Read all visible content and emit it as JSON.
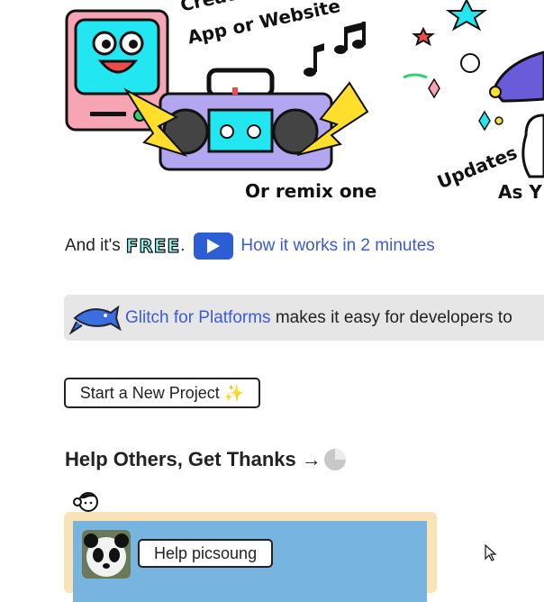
{
  "hero": {
    "create_line1": "Create an",
    "create_line2": "App or Website",
    "remix": "Or remix one",
    "updates": "Updates",
    "as_y": "As Y"
  },
  "free_line": {
    "prefix": "And it's",
    "free_badge": "FREE",
    "period": ".",
    "how_link": "How it works in 2 minutes"
  },
  "platforms": {
    "link": "Glitch for Platforms",
    "text": " makes it easy for developers to"
  },
  "start_button": "Start a New Project ✨",
  "help": {
    "heading": "Help Others, Get Thanks",
    "arrow": "→",
    "button": "Help picsoung"
  },
  "colors": {
    "accent_blue": "#3b5bd6",
    "card_border": "#fbe3b8",
    "card_fill": "#78b4e0",
    "platform_bar": "#e6e6e6"
  },
  "icons": [
    "computer-mascot-icon",
    "boombox-icon",
    "music-notes-icon",
    "star-icon",
    "fish-icon",
    "play-icon",
    "sparkles-icon",
    "progress-pie-icon",
    "person-icon",
    "panda-avatar",
    "cursor-icon"
  ]
}
